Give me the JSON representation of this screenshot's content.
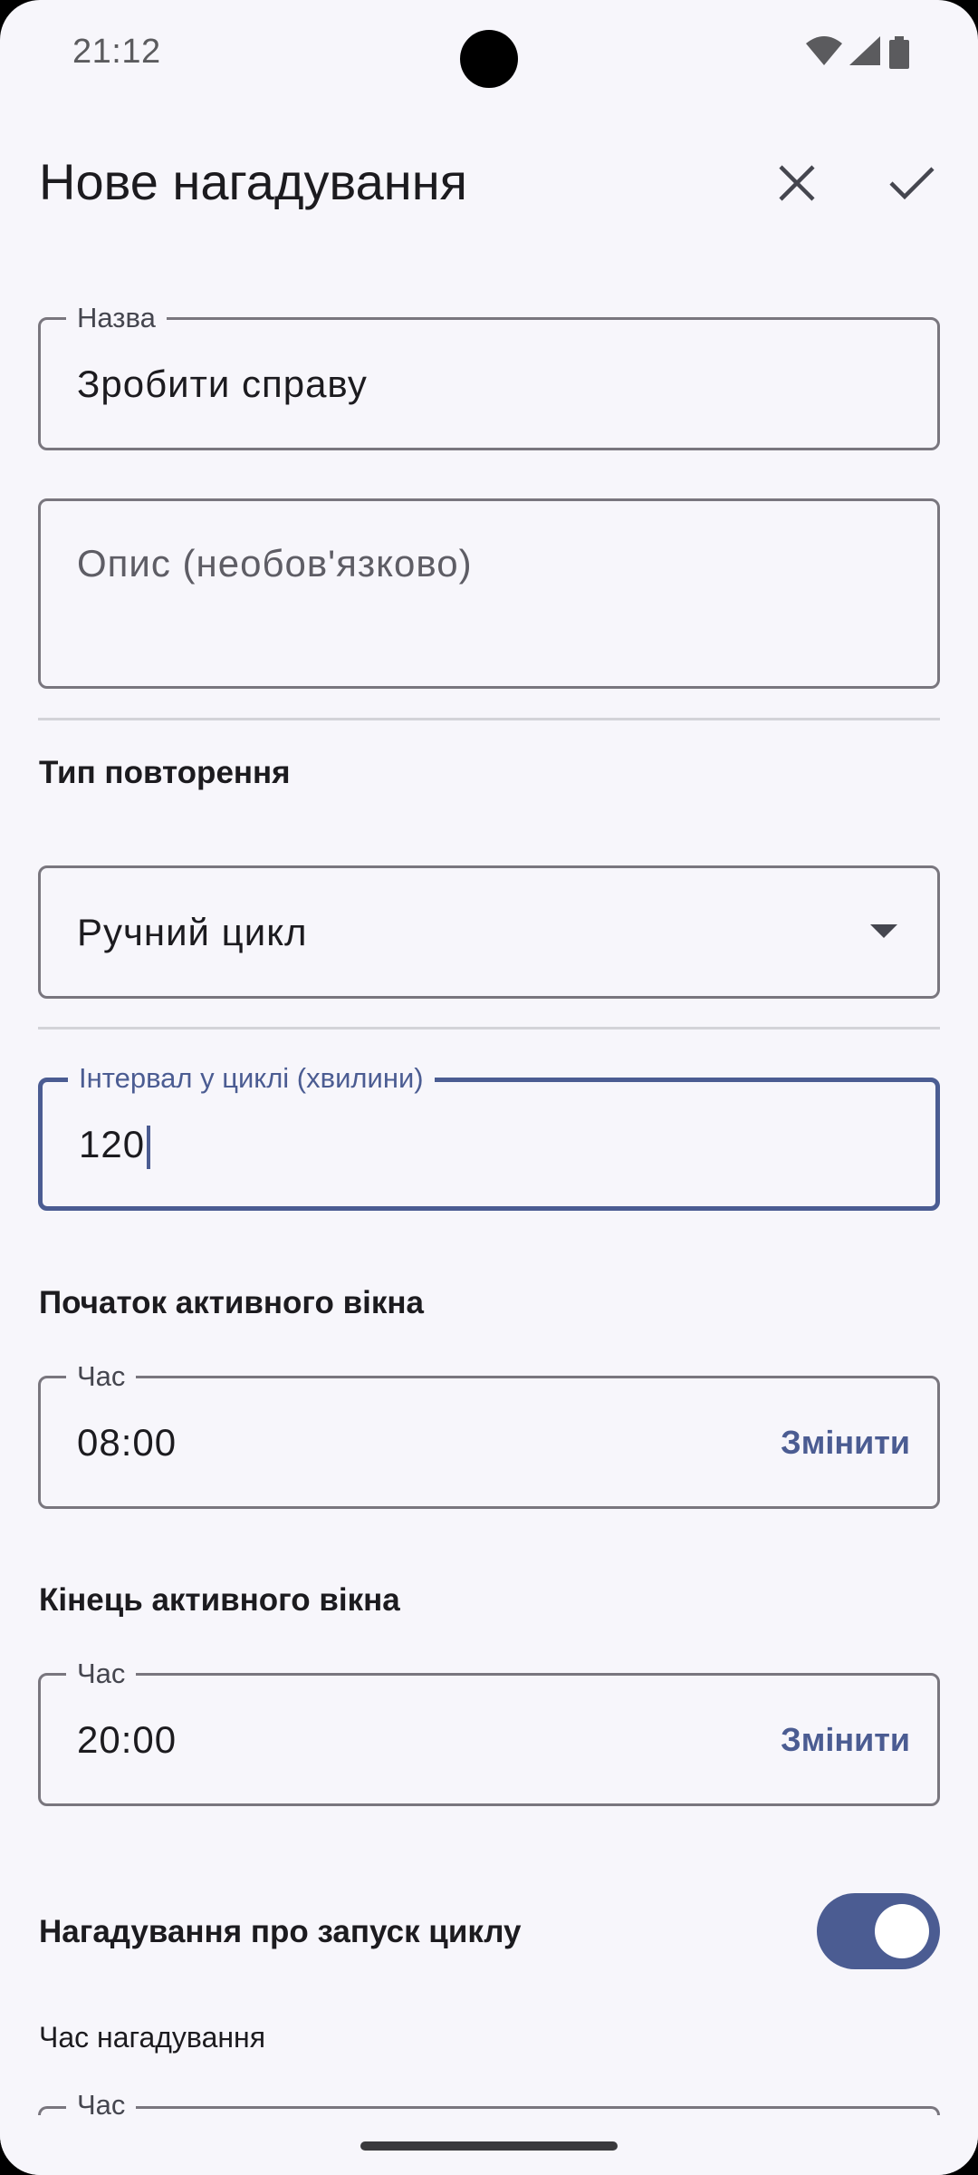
{
  "status_bar": {
    "time": "21:12",
    "icons": [
      "wifi-icon",
      "signal-icon",
      "battery-icon"
    ]
  },
  "top_bar": {
    "title": "Нове нагадування",
    "close_icon": "close-icon",
    "confirm_icon": "check-icon"
  },
  "name_field": {
    "label": "Назва",
    "value": "Зробити справу"
  },
  "description_field": {
    "placeholder": "Опис (необов'язково)"
  },
  "repeat_type": {
    "heading": "Тип повторення",
    "selected": "Ручний цикл"
  },
  "interval_field": {
    "label": "Інтервал у циклі (хвилини)",
    "value": "120"
  },
  "window_start": {
    "heading": "Початок активного вікна",
    "label": "Час",
    "value": "08:00",
    "action": "Змінити"
  },
  "window_end": {
    "heading": "Кінець активного вікна",
    "label": "Час",
    "value": "20:00",
    "action": "Змінити"
  },
  "cycle_reminder": {
    "heading": "Нагадування про запуск циклу",
    "enabled": true,
    "time_label": "Час нагадування",
    "field_label": "Час"
  },
  "colors": {
    "background": "#f7f6fb",
    "accent": "#4b5c92",
    "outline": "#79767e",
    "text": "#1c1b1f"
  }
}
